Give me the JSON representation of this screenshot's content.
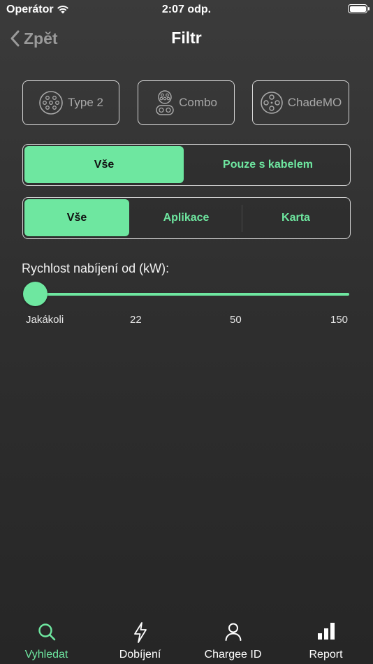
{
  "status_bar": {
    "carrier": "Operátor",
    "time": "2:07 odp."
  },
  "nav": {
    "back_label": "Zpět",
    "title": "Filtr"
  },
  "connectors": [
    {
      "label": "Type 2",
      "icon": "type2-connector-icon"
    },
    {
      "label": "Combo",
      "icon": "combo-connector-icon"
    },
    {
      "label": "ChadeMO",
      "icon": "chademo-connector-icon"
    }
  ],
  "cable_filter": {
    "options": [
      "Vše",
      "Pouze s kabelem"
    ],
    "selected": "Vše"
  },
  "access_filter": {
    "options": [
      "Vše",
      "Aplikace",
      "Karta"
    ],
    "selected": "Vše"
  },
  "speed": {
    "label": "Rychlost nabíjení od (kW):",
    "ticks": [
      "Jakákoli",
      "22",
      "50",
      "150"
    ],
    "selected": "Jakákoli"
  },
  "tabbar": {
    "items": [
      {
        "label": "Vyhledat",
        "icon": "search-icon",
        "active": true
      },
      {
        "label": "Dobíjení",
        "icon": "lightning-icon",
        "active": false
      },
      {
        "label": "Chargee ID",
        "icon": "user-icon",
        "active": false
      },
      {
        "label": "Report",
        "icon": "bar-chart-icon",
        "active": false
      }
    ]
  },
  "colors": {
    "accent": "#6ee7a0",
    "background": "#2f2f2f",
    "border": "#d6d6d6"
  }
}
